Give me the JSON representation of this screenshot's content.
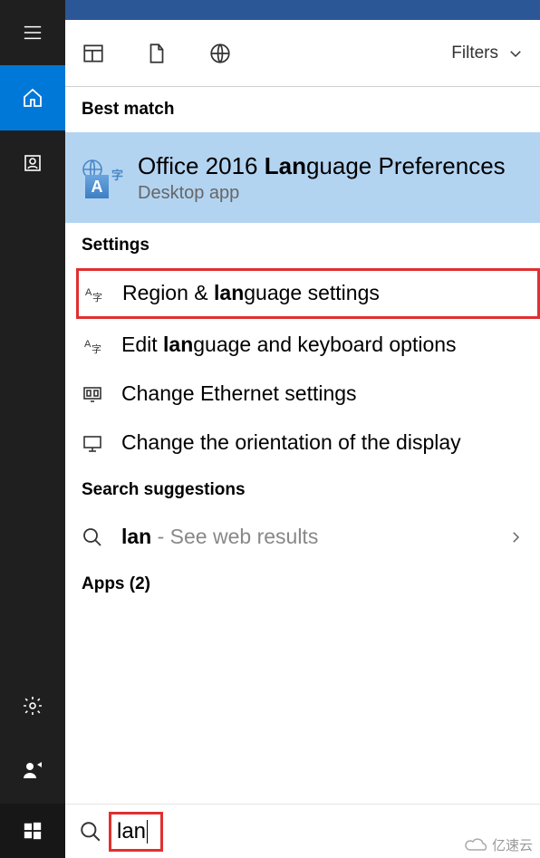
{
  "topbar": {
    "filters_label": "Filters"
  },
  "sections": {
    "best_match": "Best match",
    "settings": "Settings",
    "search_suggestions": "Search suggestions",
    "apps": "Apps (2)"
  },
  "best_result": {
    "pre": "Office 2016 ",
    "match": "Lan",
    "post": "guage Preferences",
    "subtitle": "Desktop app"
  },
  "settings_items": [
    {
      "pre": "Region & ",
      "match": "lan",
      "post": "guage settings",
      "icon": "lang"
    },
    {
      "pre": "Edit ",
      "match": "lan",
      "post": "guage and keyboard options",
      "icon": "lang"
    },
    {
      "pre": "",
      "match": "",
      "post": "Change Ethernet settings",
      "icon": "ethernet"
    },
    {
      "pre": "",
      "match": "",
      "post": "Change the orientation of the display",
      "icon": "display"
    }
  ],
  "web_suggestion": {
    "query": "lan",
    "suffix": " - See web results"
  },
  "search": {
    "value": "lan"
  },
  "watermark": "亿速云"
}
